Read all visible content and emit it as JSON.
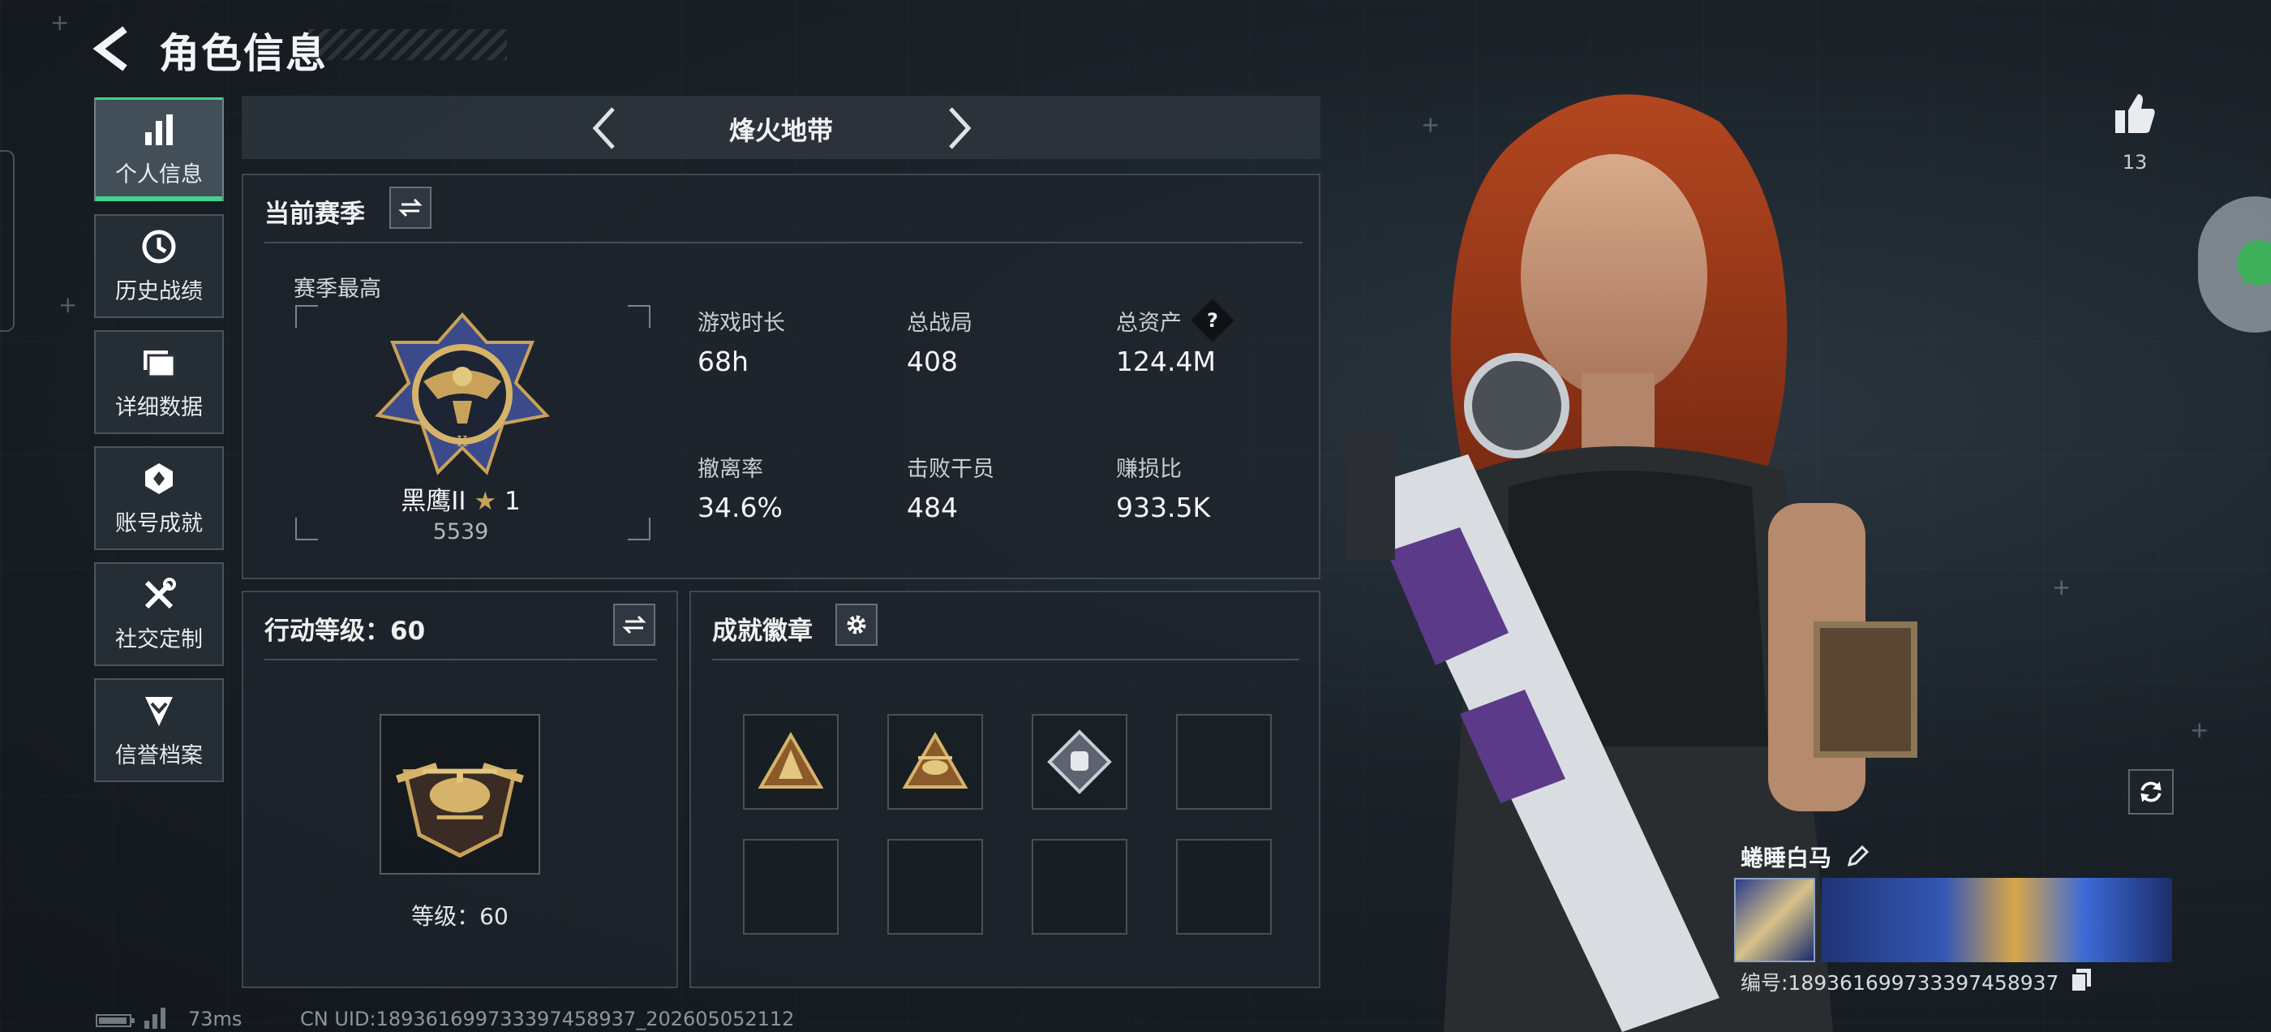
{
  "header": {
    "title": "角色信息"
  },
  "sidebar": {
    "items": [
      {
        "label": "个人信息",
        "icon": "bar-chart-icon",
        "active": true
      },
      {
        "label": "历史战绩",
        "icon": "history-clock-icon"
      },
      {
        "label": "详细数据",
        "icon": "folder-icon"
      },
      {
        "label": "账号成就",
        "icon": "achievement-icon"
      },
      {
        "label": "社交定制",
        "icon": "tools-icon"
      },
      {
        "label": "信誉档案",
        "icon": "shield-chevron-icon"
      }
    ]
  },
  "mode": {
    "name": "烽火地带"
  },
  "season": {
    "title": "当前赛季",
    "highest_label": "赛季最高",
    "rank_name": "黑鹰II",
    "rank_stars": "1",
    "rank_score": "5539",
    "stats": [
      {
        "label": "游戏时长",
        "value": "68h"
      },
      {
        "label": "总战局",
        "value": "408"
      },
      {
        "label": "总资产",
        "value": "124.4M",
        "help": "?"
      },
      {
        "label": "撤离率",
        "value": "34.6%"
      },
      {
        "label": "击败干员",
        "value": "484"
      },
      {
        "label": "赚损比",
        "value": "933.5K"
      }
    ]
  },
  "action_level": {
    "title": "行动等级：60",
    "level_text": "等级：60"
  },
  "badges": {
    "title": "成就徽章",
    "slots_filled": 3,
    "slots_total": 8
  },
  "likes": {
    "count": "13"
  },
  "player": {
    "name": "蜷睡白马",
    "id_text": "编号:1893616997333974589​37"
  },
  "status_bar": {
    "ping": "73ms",
    "uid": "CN UID:189361699733397458937_202605052112"
  },
  "colors": {
    "accent_green": "#3fd48a",
    "gold": "#c9a25a"
  }
}
